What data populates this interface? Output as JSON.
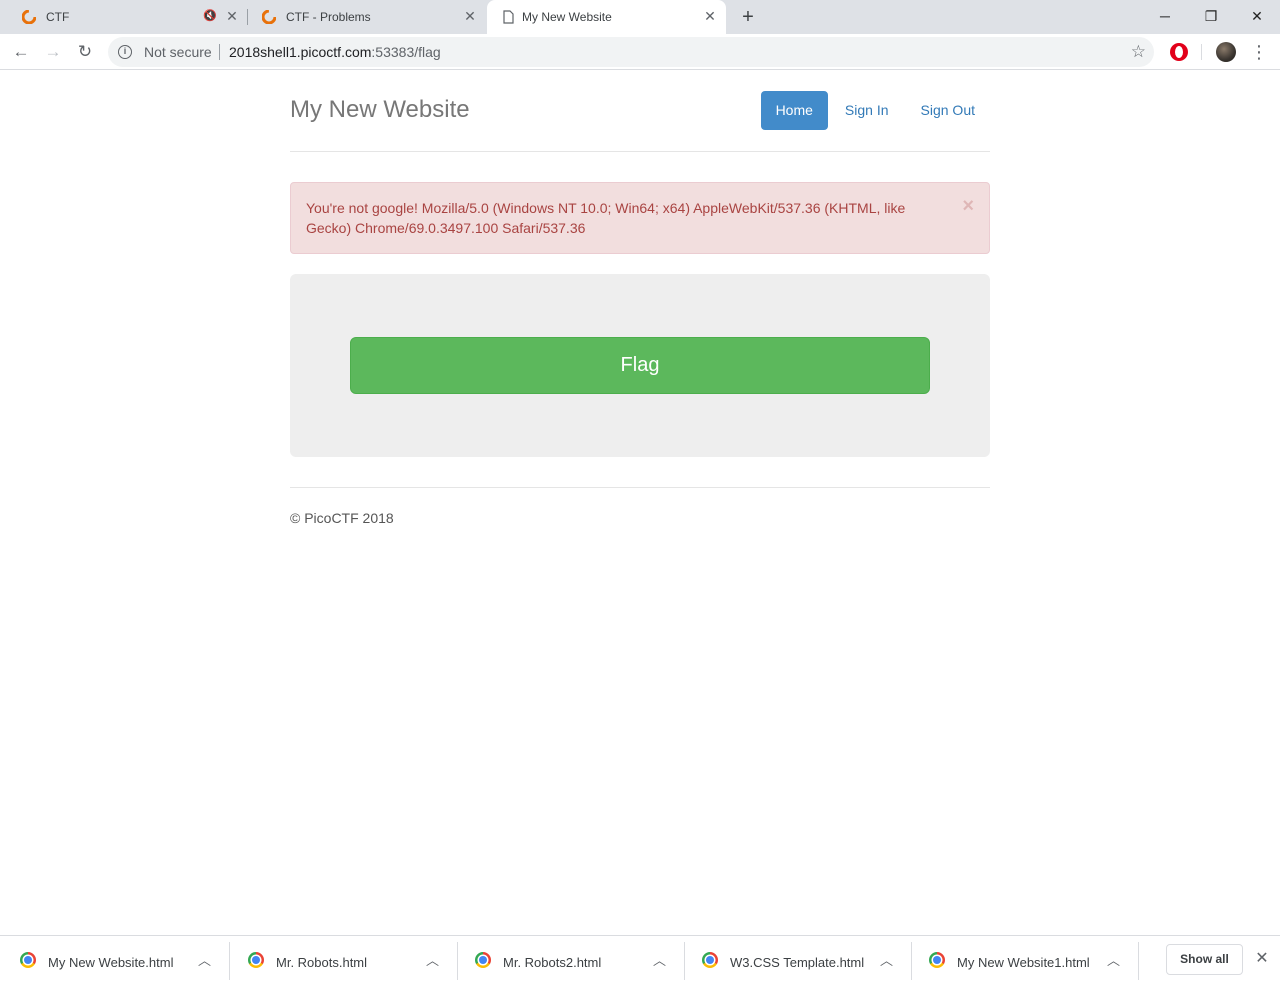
{
  "browser": {
    "tabs": [
      {
        "title": "CTF"
      },
      {
        "title": "CTF - Problems"
      },
      {
        "title": "My New Website"
      }
    ],
    "address": {
      "security_label": "Not secure",
      "host": "2018shell1.picoctf.com",
      "rest": ":53383/flag"
    }
  },
  "site": {
    "title": "My New Website",
    "nav": [
      {
        "label": "Home",
        "active": true
      },
      {
        "label": "Sign In",
        "active": false
      },
      {
        "label": "Sign Out",
        "active": false
      }
    ],
    "alert": {
      "message": "You're not google! Mozilla/5.0 (Windows NT 10.0; Win64; x64) AppleWebKit/537.36 (KHTML, like Gecko) Chrome/69.0.3497.100 Safari/537.36",
      "close_symbol": "×"
    },
    "flag_button": "Flag",
    "footer": "© PicoCTF 2018"
  },
  "downloads": {
    "items": [
      {
        "name": "My New Website.html"
      },
      {
        "name": "Mr. Robots.html"
      },
      {
        "name": "Mr. Robots2.html"
      },
      {
        "name": "W3.CSS Template.html"
      },
      {
        "name": "My New Website1.html"
      }
    ],
    "show_all": "Show all"
  },
  "colors": {
    "primary": "#428bca",
    "success": "#5cb85c",
    "danger_bg": "#f2dede",
    "danger_text": "#a94442"
  }
}
